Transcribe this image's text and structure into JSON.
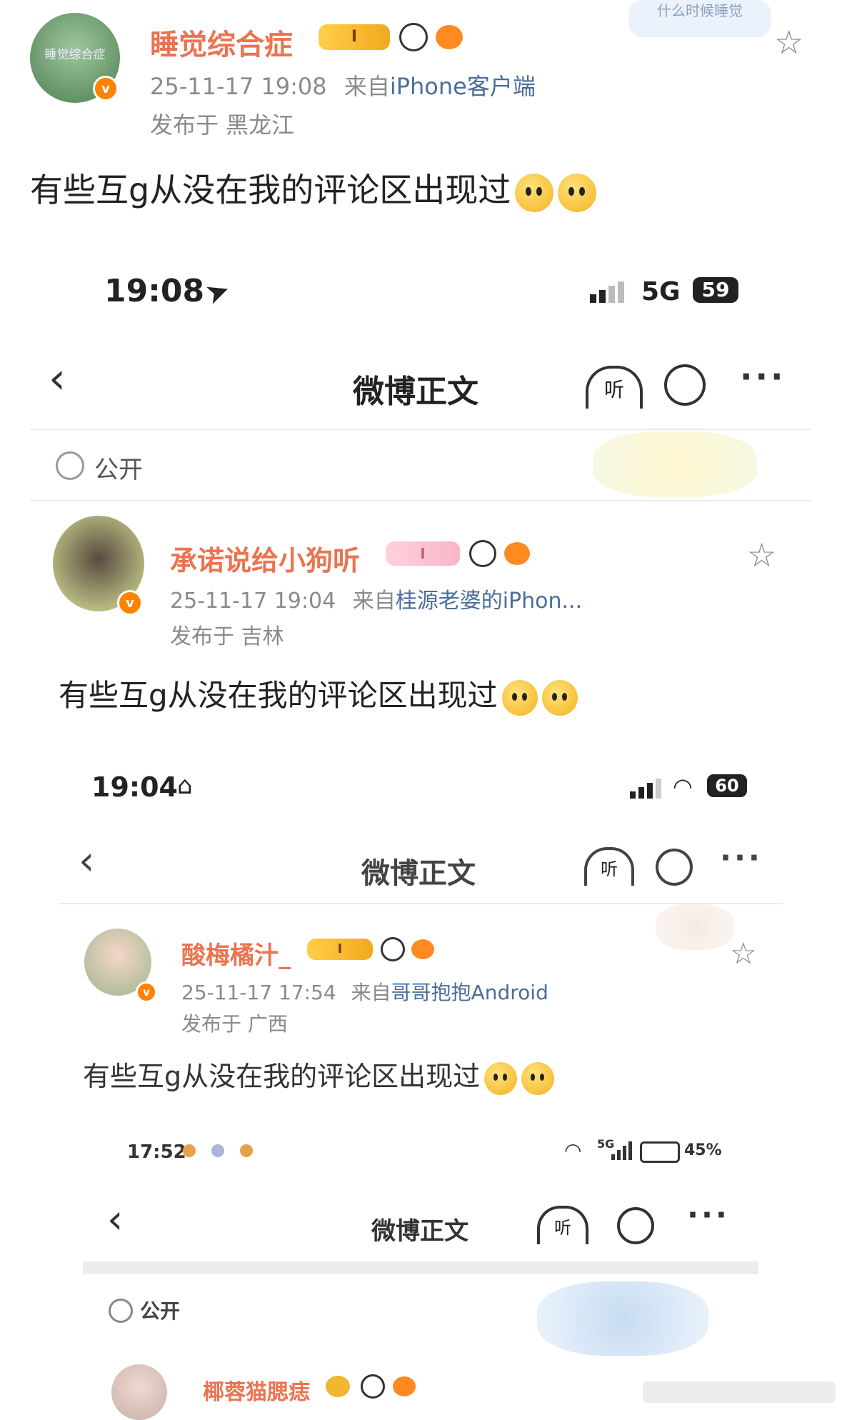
{
  "outer_post": {
    "username": "睡觉综合症",
    "time": "25-11-17 19:08",
    "source_prefix": "来自",
    "source": "iPhone客户端",
    "location": "发布于 黑龙江",
    "text": "有些互g从没在我的评论区出现过",
    "badge_label": "I",
    "sticker_text": "什么时候睡觉",
    "avatar_text": "睡觉综合症"
  },
  "shot1": {
    "status_time": "19:08",
    "network": "5G",
    "battery": "59",
    "nav_title": "微博正文",
    "listen_label": "听",
    "visibility": "公开",
    "post": {
      "username": "承诺说给小狗听",
      "badge_label": "I",
      "time": "25-11-17 19:04",
      "source_prefix": "来自",
      "source": "桂源老婆的iPhon...",
      "location": "发布于 吉林",
      "text": "有些互g从没在我的评论区出现过"
    }
  },
  "shot2": {
    "status_time": "19:04",
    "battery": "60",
    "nav_title": "微博正文",
    "listen_label": "听",
    "post": {
      "username": "酸梅橘汁_",
      "badge_label": "I",
      "time": "25-11-17 17:54",
      "source_prefix": "来自",
      "source": "哥哥抱抱Android",
      "location": "发布于 广西",
      "text": "有些互g从没在我的评论区出现过"
    }
  },
  "shot3": {
    "status_time": "17:52",
    "battery": "45%",
    "network": "5G",
    "nav_title": "微博正文",
    "listen_label": "听",
    "visibility": "公开",
    "post": {
      "username": "椰蓉猫腮痣"
    }
  },
  "colors": {
    "username": "#eb7350",
    "verified": "#ff8200",
    "source_link": "#4a6d9c",
    "meta": "#8a8a8a"
  }
}
